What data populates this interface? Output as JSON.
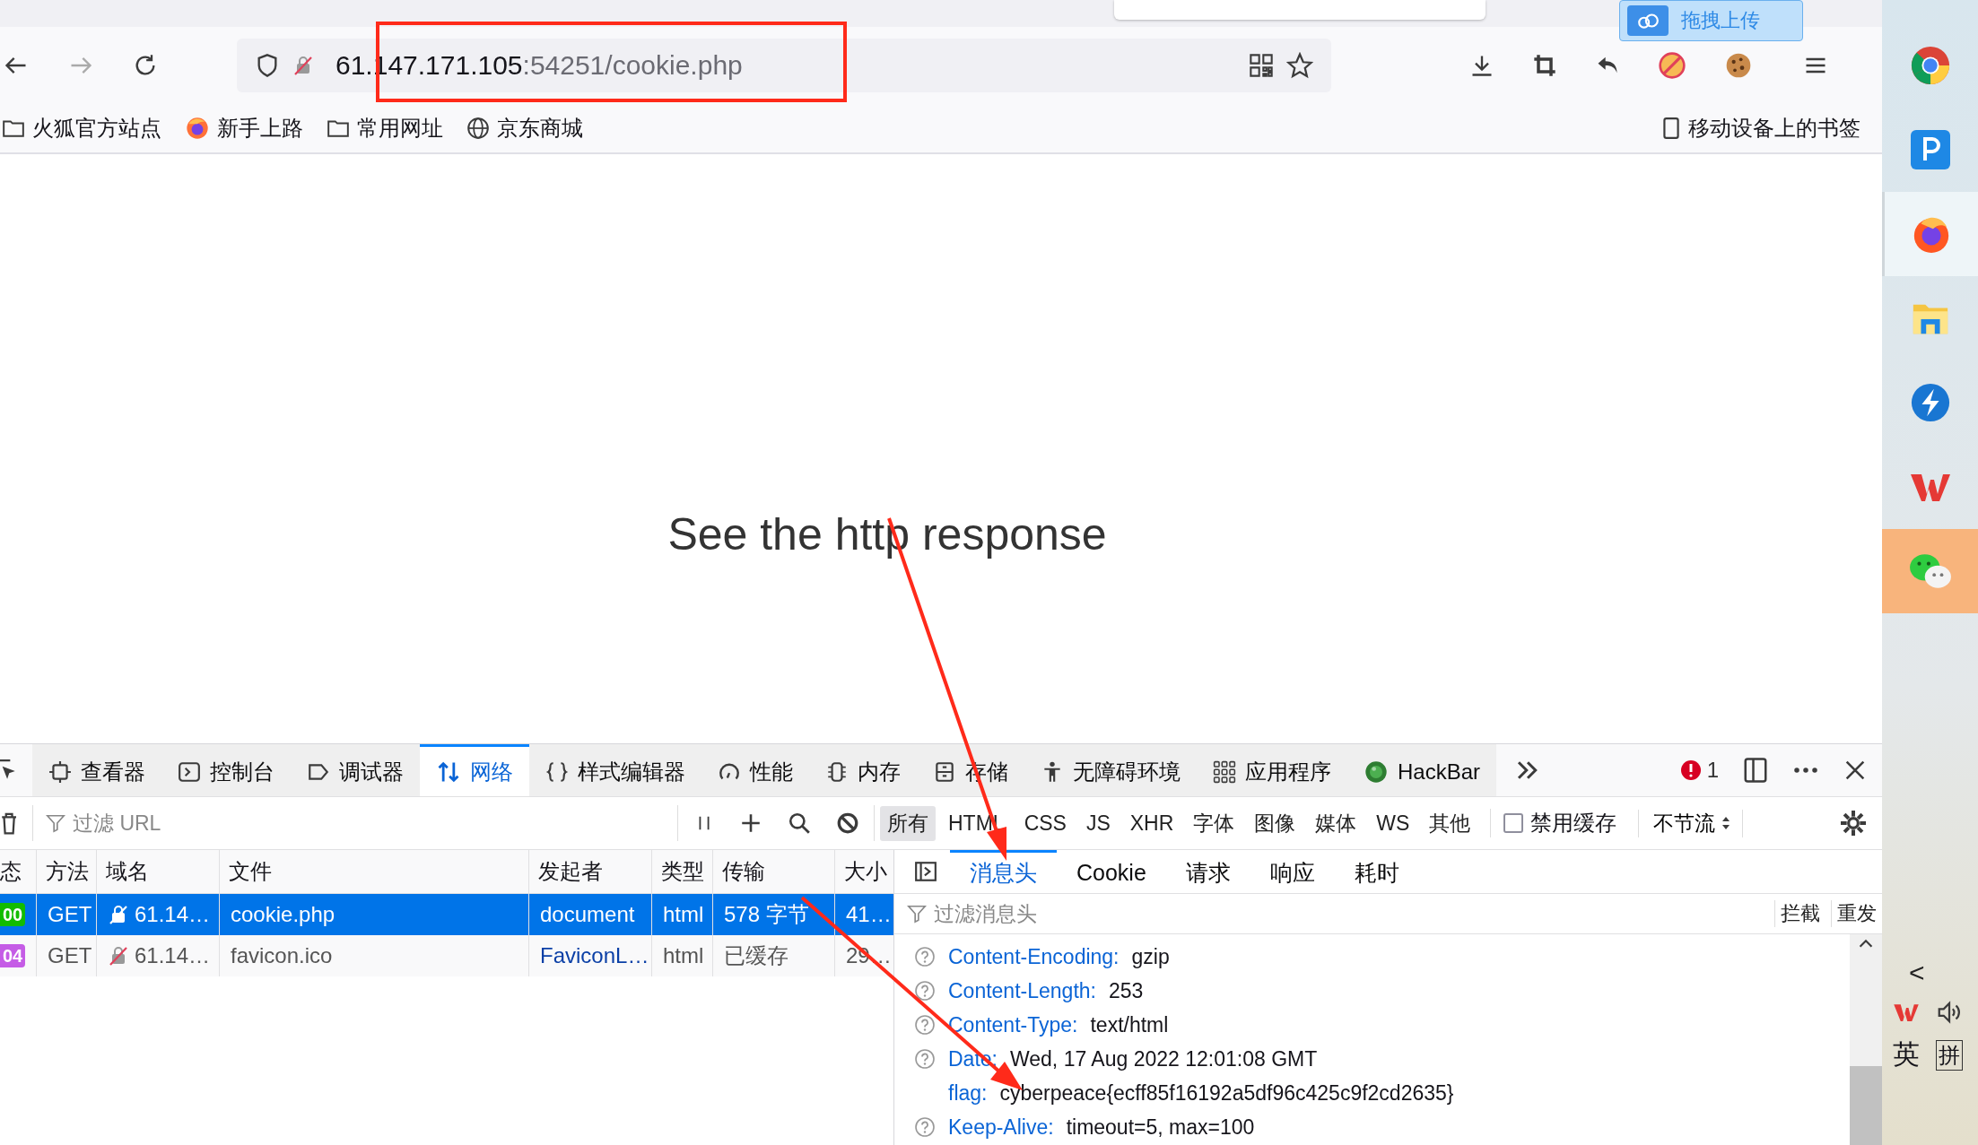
{
  "top_strip": {
    "upload_button": "拖拽上传"
  },
  "address_bar": {
    "host": "61.147.171.105",
    "rest": ":54251/cookie.php"
  },
  "bookmarks": [
    {
      "kind": "folder",
      "label": "火狐官方站点"
    },
    {
      "kind": "firefox",
      "label": "新手上路"
    },
    {
      "kind": "folder",
      "label": "常用网址"
    },
    {
      "kind": "globe",
      "label": "京东商城"
    }
  ],
  "mobile_bookmarks": "移动设备上的书签",
  "page": {
    "text": "See the http response"
  },
  "devtools": {
    "tabs": [
      {
        "kind": "inspector",
        "label": "查看器",
        "selected": false
      },
      {
        "kind": "console",
        "label": "控制台",
        "selected": false
      },
      {
        "kind": "debugger",
        "label": "调试器",
        "selected": false
      },
      {
        "kind": "network",
        "label": "网络",
        "selected": true
      },
      {
        "kind": "style",
        "label": "样式编辑器",
        "selected": false
      },
      {
        "kind": "performance",
        "label": "性能",
        "selected": false
      },
      {
        "kind": "memory",
        "label": "内存",
        "selected": false
      },
      {
        "kind": "storage",
        "label": "存储",
        "selected": false
      },
      {
        "kind": "accessibility",
        "label": "无障碍环境",
        "selected": false
      },
      {
        "kind": "application",
        "label": "应用程序",
        "selected": false
      },
      {
        "kind": "hackbar",
        "label": "HackBar",
        "selected": false
      }
    ],
    "error_count": "1",
    "filter_placeholder": "过滤 URL",
    "type_filters": [
      {
        "label": "所有",
        "selected": true
      },
      {
        "label": "HTML",
        "selected": false
      },
      {
        "label": "CSS",
        "selected": false
      },
      {
        "label": "JS",
        "selected": false
      },
      {
        "label": "XHR",
        "selected": false
      },
      {
        "label": "字体",
        "selected": false
      },
      {
        "label": "图像",
        "selected": false
      },
      {
        "label": "媒体",
        "selected": false
      },
      {
        "label": "WS",
        "selected": false
      },
      {
        "label": "其他",
        "selected": false
      }
    ],
    "disable_cache": {
      "label": "禁用缓存",
      "checked": false
    },
    "throttle": "不节流",
    "columns": [
      "态",
      "方法",
      "域名",
      "文件",
      "发起者",
      "类型",
      "传输",
      "大小"
    ],
    "rows": [
      {
        "status": "00",
        "color": "#12bc00",
        "method": "GET",
        "domain": "61.14…",
        "file": "cookie.php",
        "initiator": "document",
        "type": "html",
        "transfer": "578 字节",
        "size": "41…",
        "selected": true
      },
      {
        "status": "04",
        "color": "#c55ce6",
        "method": "GET",
        "domain": "61.14…",
        "file": "favicon.ico",
        "initiator": "FaviconL…",
        "type": "html",
        "transfer": "已缓存",
        "size": "29…",
        "selected": false
      }
    ],
    "detail_tabs": [
      {
        "label": "消息头",
        "selected": true
      },
      {
        "label": "Cookie",
        "selected": false
      },
      {
        "label": "请求",
        "selected": false
      },
      {
        "label": "响应",
        "selected": false
      },
      {
        "label": "耗时",
        "selected": false
      }
    ],
    "header_filter_placeholder": "过滤消息头",
    "header_buttons": [
      "拦截",
      "重发"
    ],
    "headers": [
      {
        "name": "Content-Encoding:",
        "value": "gzip",
        "help": true
      },
      {
        "name": "Content-Length:",
        "value": "253",
        "help": true
      },
      {
        "name": "Content-Type:",
        "value": "text/html",
        "help": true
      },
      {
        "name": "Date:",
        "value": "Wed, 17 Aug 2022 12:01:08 GMT",
        "help": true
      },
      {
        "name": "flag:",
        "value": "cyberpeace{ecff85f16192a5df96c425c9f2cd2635}",
        "help": false
      },
      {
        "name": "Keep-Alive:",
        "value": "timeout=5, max=100",
        "help": true
      }
    ]
  },
  "taskbar": {
    "apps": [
      {
        "kind": "chrome",
        "active": false,
        "highlighted": false
      },
      {
        "kind": "p-app",
        "active": false,
        "highlighted": false
      },
      {
        "kind": "firefox",
        "active": true,
        "highlighted": false
      },
      {
        "kind": "explorer",
        "active": false,
        "highlighted": false
      },
      {
        "kind": "lightning",
        "active": false,
        "highlighted": false
      },
      {
        "kind": "wps",
        "active": false,
        "highlighted": false
      },
      {
        "kind": "wechat",
        "active": false,
        "highlighted": true
      }
    ],
    "tray_chevron": "<",
    "input_language": "英",
    "input_mode": "拼"
  }
}
